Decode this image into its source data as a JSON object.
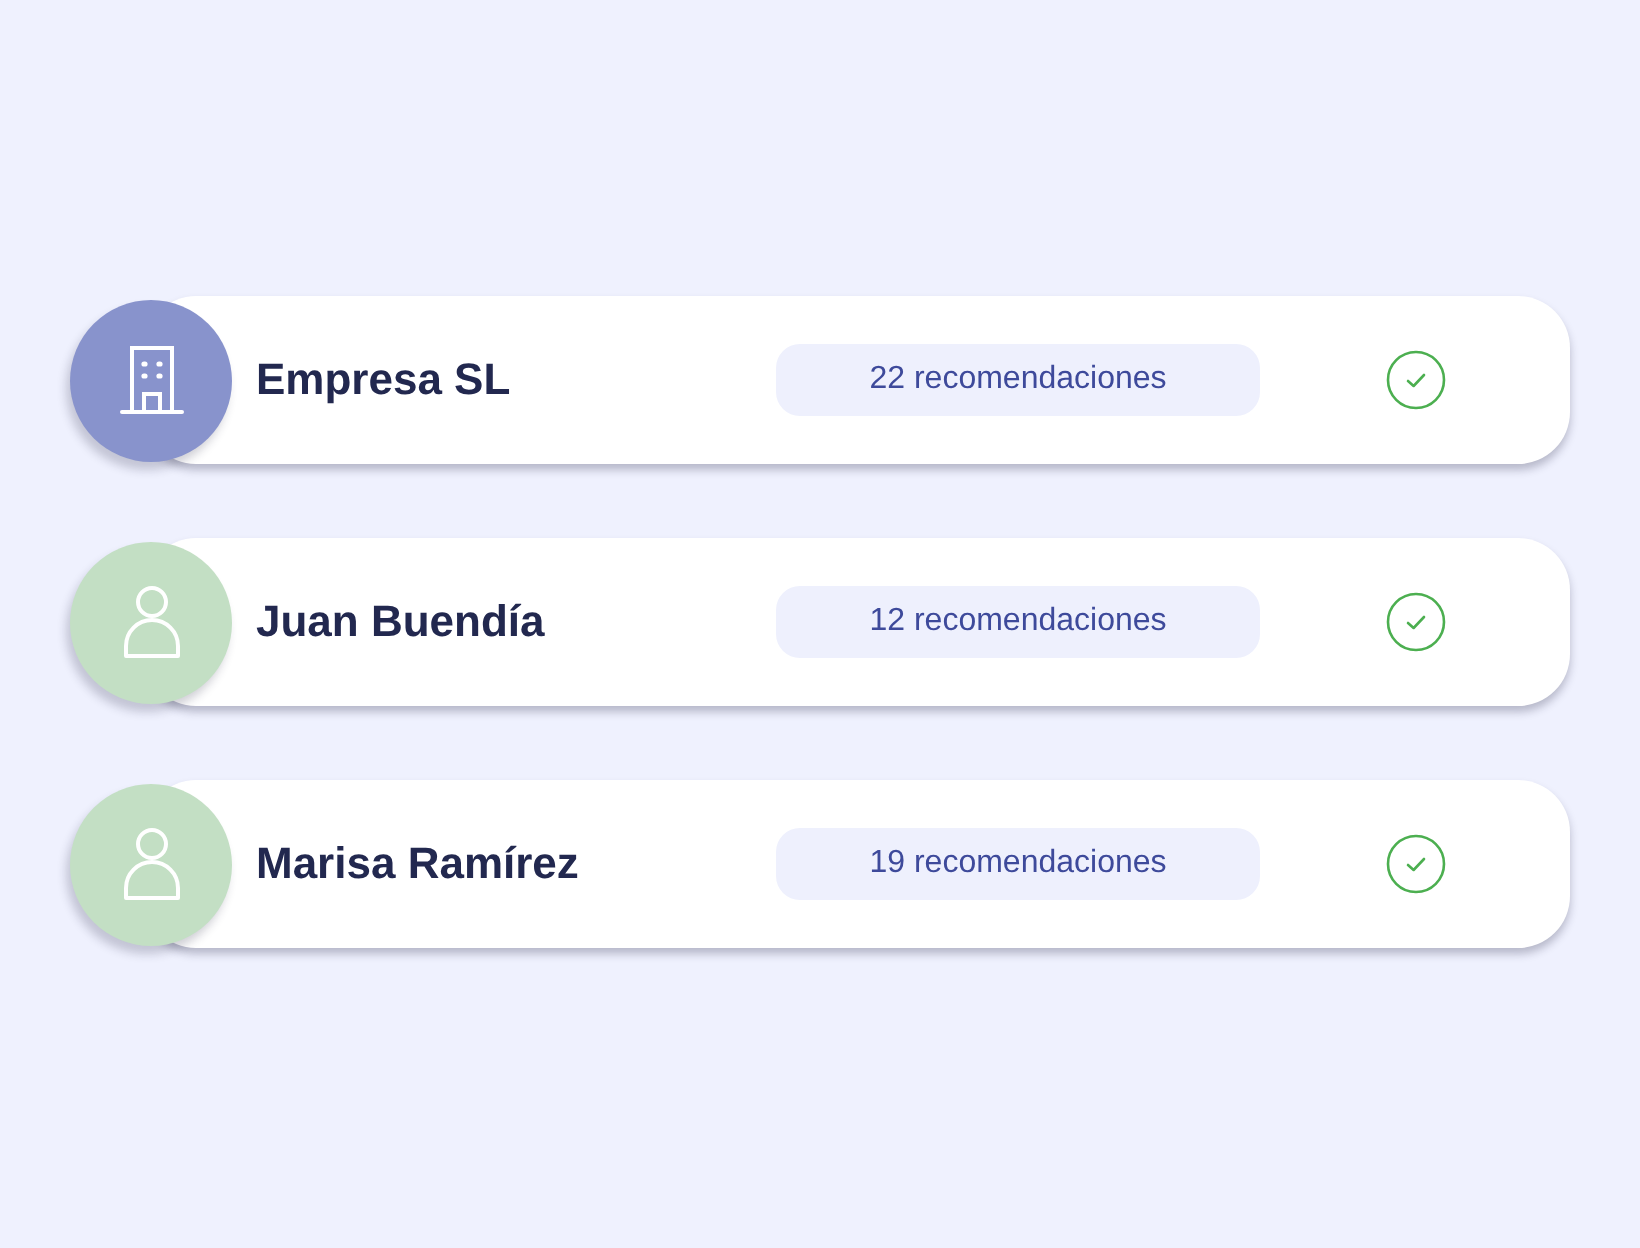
{
  "cards": [
    {
      "name": "Empresa SL",
      "avatar": {
        "kind": "company",
        "color": "#8893cc"
      },
      "recommendations": "22 recomendaciones",
      "verified": true
    },
    {
      "name": "Juan Buendía",
      "avatar": {
        "kind": "person",
        "color": "#c3dfc4"
      },
      "recommendations": "12 recomendaciones",
      "verified": true
    },
    {
      "name": "Marisa Ramírez",
      "avatar": {
        "kind": "person",
        "color": "#c3dfc4"
      },
      "recommendations": "19 recomendaciones",
      "verified": true
    }
  ]
}
